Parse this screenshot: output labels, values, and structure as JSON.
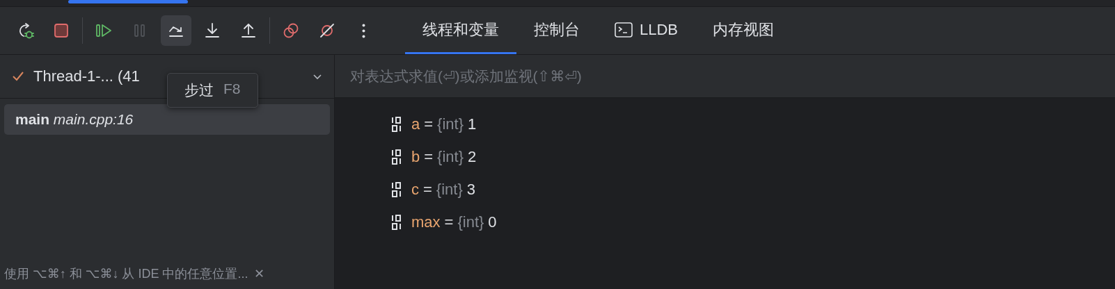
{
  "toolbar": {
    "groups": [
      [
        {
          "kind": "rerun",
          "hovered": false,
          "disabled": false
        },
        {
          "kind": "stop",
          "hovered": false,
          "disabled": false
        }
      ],
      [
        {
          "kind": "resume",
          "hovered": false,
          "disabled": false
        },
        {
          "kind": "pause",
          "hovered": false,
          "disabled": true
        },
        {
          "kind": "step-over",
          "hovered": true,
          "disabled": false
        },
        {
          "kind": "step-into",
          "hovered": false,
          "disabled": false
        },
        {
          "kind": "step-out",
          "hovered": false,
          "disabled": false
        }
      ],
      [
        {
          "kind": "breakpoints",
          "hovered": false,
          "disabled": false
        },
        {
          "kind": "mute",
          "hovered": false,
          "disabled": false
        },
        {
          "kind": "more",
          "hovered": false,
          "disabled": false
        }
      ]
    ]
  },
  "tabs": [
    {
      "label": "线程和变量",
      "kind": "text",
      "selected": true
    },
    {
      "label": "控制台",
      "kind": "text",
      "selected": false
    },
    {
      "label": "LLDB",
      "kind": "terminal",
      "selected": false
    },
    {
      "label": "内存视图",
      "kind": "text",
      "selected": false
    }
  ],
  "thread": {
    "label": "Thread-1-... (41",
    "checked": true
  },
  "tooltip": {
    "label": "步过",
    "shortcut": "F8"
  },
  "frames": [
    {
      "function": "main",
      "location": "main.cpp:16",
      "selected": true
    }
  ],
  "evaluate": {
    "placeholder": "对表达式求值(⏎)或添加监视(⇧⌘⏎)"
  },
  "variables": [
    {
      "name": "a",
      "operator": "=",
      "type": "{int}",
      "value": "1"
    },
    {
      "name": "b",
      "operator": "=",
      "type": "{int}",
      "value": "2"
    },
    {
      "name": "c",
      "operator": "=",
      "type": "{int}",
      "value": "3"
    },
    {
      "name": "max",
      "operator": "=",
      "type": "{int}",
      "value": "0"
    }
  ],
  "hint": {
    "text": "使用 ⌥⌘↑ 和 ⌥⌘↓ 从 IDE 中的任意位置...",
    "close": "✕"
  }
}
